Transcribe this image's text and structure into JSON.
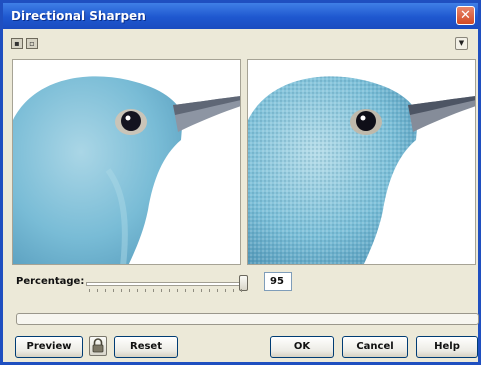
{
  "window": {
    "title": "Directional Sharpen",
    "close_glyph": "✕"
  },
  "toolbar": {
    "icons": [
      "toggle-preview-icon",
      "split-view-icon"
    ],
    "menu_glyph": "▼"
  },
  "preview": {
    "original_alt": "original-bird-preview",
    "result_alt": "sharpened-bird-preview"
  },
  "controls": {
    "percentage_label": "Percentage:",
    "percentage_value": "95"
  },
  "progress": {
    "fraction": 0
  },
  "buttons": {
    "preview": "Preview",
    "reset": "Reset",
    "ok": "OK",
    "cancel": "Cancel",
    "help": "Help"
  },
  "colors": {
    "titlebar": "#1e57cf",
    "dialog_bg": "#ece9d8",
    "bird_blue": "#7fc1d9"
  }
}
